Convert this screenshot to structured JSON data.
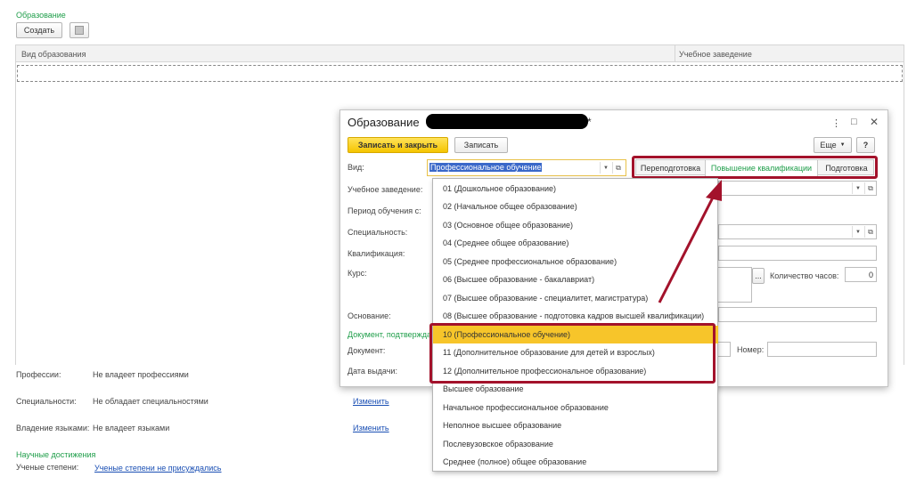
{
  "section": {
    "title": "Образование",
    "create_label": "Создать",
    "columns": [
      "Вид образования",
      "Учебное заведение"
    ]
  },
  "info": {
    "professions_label": "Профессии:",
    "professions_value": "Не владеет профессиями",
    "specialties_label": "Специальности:",
    "specialties_value": "Не обладает специальностями",
    "languages_label": "Владение языками:",
    "languages_value": "Не владеет языками",
    "change_link": "Изменить",
    "science_title": "Научные достижения",
    "degrees_label": "Ученые степени:",
    "degrees_value": "Ученые степени не присуждались"
  },
  "dialog": {
    "title": "Образование",
    "title_suffix": "*",
    "save_close_label": "Записать и закрыть",
    "save_label": "Записать",
    "more_label": "Еще",
    "help_label": "?",
    "window_controls": [
      "⋮",
      "□",
      "✕"
    ],
    "fields": {
      "vid_label": "Вид:",
      "vid_value": "Профессиональное обучение",
      "institution_label": "Учебное заведение:",
      "period_label": "Период обучения с:",
      "specialty_label": "Специальность:",
      "qualification_label": "Квалификация:",
      "course_label": "Курс:",
      "hours_label": "Количество часов:",
      "hours_value": "0",
      "basis_label": "Основание:",
      "doc_confirm_label": "Документ, подтверждающий",
      "document_label": "Документ:",
      "number_label": "Номер:",
      "issue_date_label": "Дата выдачи:"
    },
    "tabs": [
      "Переподготовка",
      "Повышение квалификации",
      "Подготовка"
    ]
  },
  "dropdown": {
    "items": [
      "01 (Дошкольное образование)",
      "02 (Начальное общее образование)",
      "03 (Основное общее образование)",
      "04 (Среднее общее образование)",
      "05 (Среднее профессиональное образование)",
      "06 (Высшее образование - бакалавриат)",
      "07 (Высшее образование - специалитет, магистратура)",
      "08 (Высшее образование - подготовка кадров высшей квалификации)",
      "10 (Профессиональное обучение)",
      "11 (Дополнительное образование для детей и взрослых)",
      "12 (Дополнительное профессиональное образование)",
      "Высшее образование",
      "Начальное профессиональное образование",
      "Неполное высшее образование",
      "Послевузовское образование",
      "Среднее (полное) общее образование"
    ],
    "selected_index": 8
  },
  "colors": {
    "accent_green": "#1f9e4a",
    "highlight_red": "#a3122b",
    "selected_yellow": "#f7c52a",
    "primary_button": "#f5c400"
  }
}
